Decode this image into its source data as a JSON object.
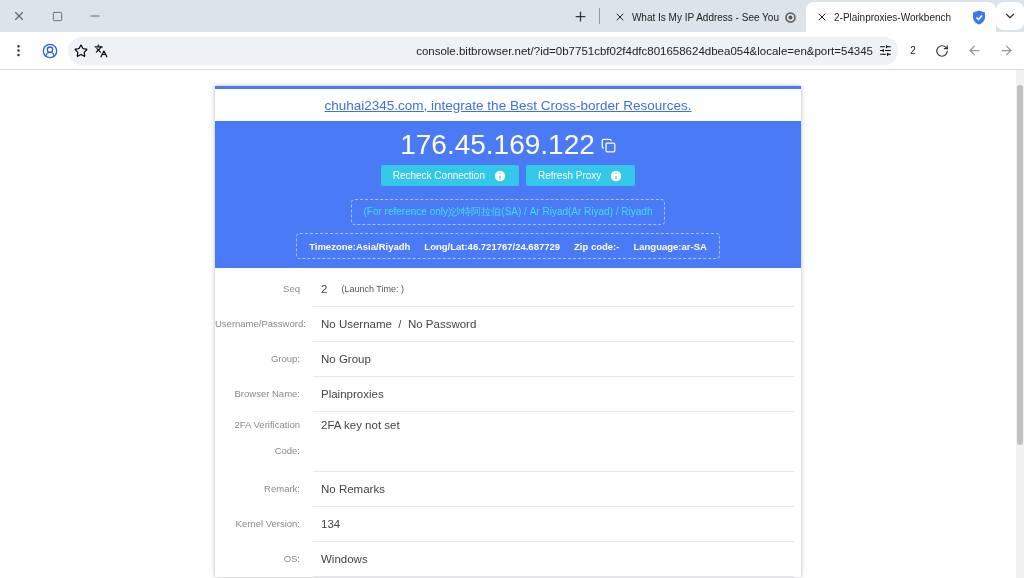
{
  "tabs": [
    {
      "title": "What Is My IP Address - See You",
      "selected": false
    },
    {
      "title": "2-Plainproxies-Workbench",
      "selected": true
    }
  ],
  "address_bar": {
    "url": "console.bitbrowser.net/?id=0b7751cbf02f4dfc801658624dbea054&locale=en&port=54345",
    "badge": "2"
  },
  "page": {
    "banner_link": "chuhai2345.com, integrate the Best Cross-border Resources.",
    "ip": "176.45.169.122",
    "buttons": [
      "Recheck Connection",
      "Refresh Proxy"
    ],
    "location": "(For reference only)沙特阿拉伯(SA) / Ar Riyad(Ar Riyad) / Riyadh",
    "details": [
      "Timezone:Asia/Riyadh",
      "Long/Lat:46.721767/24.687729",
      "Zip code:-",
      "Language:ar-SA"
    ],
    "fields": [
      {
        "label": "Seq",
        "value": "2",
        "note": "(Launch Time: )"
      },
      {
        "label": "Username/Password:",
        "value": "No Username  /  No Password"
      },
      {
        "label": "Group:",
        "value": "No Group"
      },
      {
        "label": "Browser Name:",
        "value": "Plainproxies"
      },
      {
        "label": "2FA Verification Code:",
        "value": "2FA key not set"
      },
      {
        "label": "Remark:",
        "value": "No Remarks"
      },
      {
        "label": "Kernel Version:",
        "value": "134"
      },
      {
        "label": "OS:",
        "value": "Windows"
      }
    ]
  }
}
